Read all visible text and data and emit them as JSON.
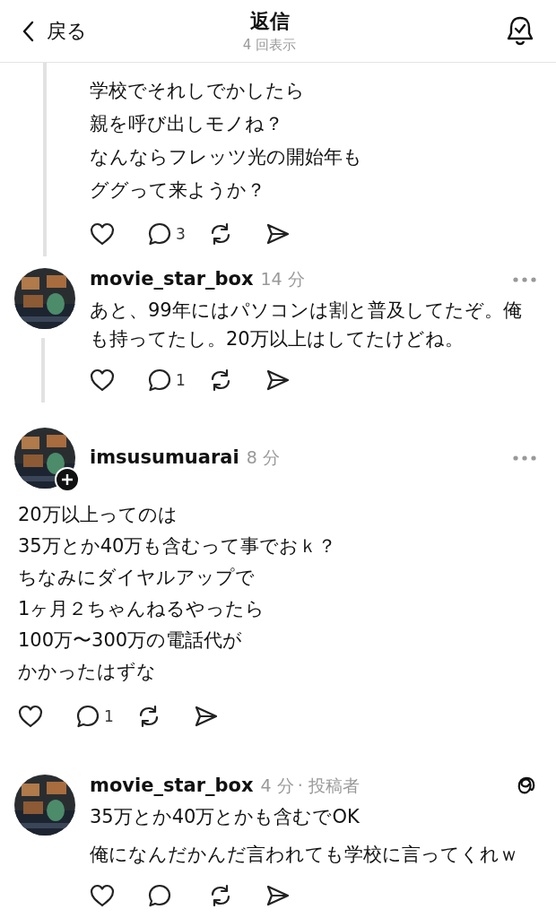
{
  "header": {
    "back_label": "戻る",
    "title": "返信",
    "subtitle": "4 回表示"
  },
  "posts": [
    {
      "kind": "continuation",
      "connector": true,
      "lines": [
        "学校でそれしでかしたら",
        "親を呼び出しモノね？",
        "なんならフレッツ光の開始年も",
        "ググって来ようか？"
      ],
      "reply_count": "3"
    },
    {
      "kind": "reply",
      "connector": true,
      "follow_badge": false,
      "username": "movie_star_box",
      "time": "14 分",
      "menu": {
        "kind": "more"
      },
      "paragraphs": [
        "あと、99年にはパソコンは割と普及してたぞ。俺も持ってたし。20万以上はしてたけどね。"
      ],
      "reply_count": "1"
    },
    {
      "kind": "full_width",
      "connector": false,
      "follow_badge": true,
      "username": "imsusumuarai",
      "time": "8 分",
      "menu": {
        "kind": "more"
      },
      "lines": [
        "20万以上ってのは",
        "35万とか40万も含むって事でおｋ？",
        "ちなみにダイヤルアップで",
        "1ヶ月２ちゃんねるやったら",
        "100万〜300万の電話代が",
        "かかったはずな"
      ],
      "reply_count": "1"
    },
    {
      "kind": "reply",
      "connector": false,
      "follow_badge": false,
      "username": "movie_star_box",
      "time": "4 分",
      "author_tag": "· 投稿者",
      "menu": {
        "kind": "threads"
      },
      "paragraphs": [
        "35万とか40万とかも含むでOK",
        "俺になんだかんだ言われても学校に言ってくれｗ"
      ]
    }
  ]
}
